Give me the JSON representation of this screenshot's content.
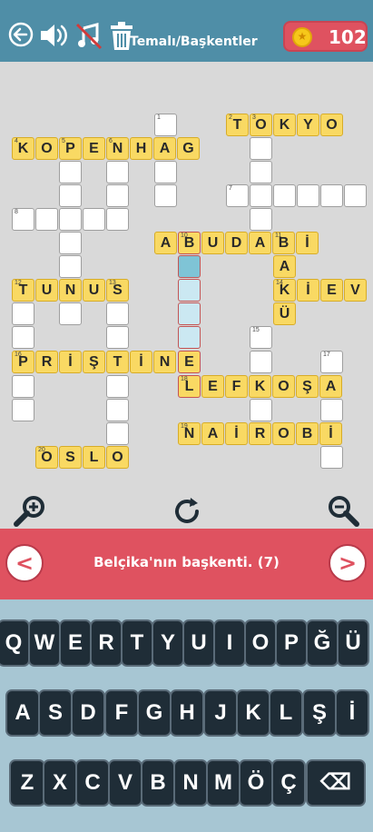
{
  "header": {
    "title": "Temalı/Başkentler",
    "coins": "102",
    "coin_symbol": "★"
  },
  "puzzle": {
    "numbers": [
      "1",
      "2",
      "3",
      "4",
      "5",
      "6",
      "7",
      "8",
      "10",
      "11",
      "12",
      "13",
      "14",
      "15",
      "16",
      "17",
      "18",
      "19",
      "20"
    ],
    "letters": {
      "tokyo": [
        "T",
        "O",
        "K",
        "Y",
        "O"
      ],
      "kopenhag": [
        "K",
        "O",
        "P",
        "E",
        "N",
        "H",
        "A",
        "G"
      ],
      "abudabi": [
        "A",
        "B",
        "U",
        "D",
        "A",
        "B",
        "İ"
      ],
      "akiev_down": [
        "A",
        "Ü"
      ],
      "tunus": [
        "T",
        "U",
        "N",
        "U",
        "S"
      ],
      "kiev": [
        "K",
        "İ",
        "E",
        "V"
      ],
      "pristine": [
        "P",
        "R",
        "İ",
        "Ş",
        "T",
        "İ",
        "N",
        "E"
      ],
      "lefkosa": [
        "L",
        "E",
        "F",
        "K",
        "O",
        "Ş",
        "A"
      ],
      "nairobi": [
        "N",
        "A",
        "İ",
        "R",
        "O",
        "B",
        "İ"
      ],
      "oslo": [
        "O",
        "S",
        "L",
        "O"
      ]
    }
  },
  "clue": {
    "text": "Belçika'nın başkenti. (7)",
    "prev": "<",
    "next": ">"
  },
  "keyboard": {
    "row1": [
      "Q",
      "W",
      "E",
      "R",
      "T",
      "Y",
      "U",
      "I",
      "O",
      "P",
      "Ğ",
      "Ü"
    ],
    "row2": [
      "A",
      "S",
      "D",
      "F",
      "G",
      "H",
      "J",
      "K",
      "L",
      "Ş",
      "İ"
    ],
    "row3": [
      "Z",
      "X",
      "C",
      "V",
      "B",
      "N",
      "M",
      "Ö",
      "Ç"
    ],
    "backspace": "⌫"
  },
  "icons": [
    "back-arrow-icon",
    "volume-icon",
    "music-off-icon",
    "trash-icon",
    "zoom-in-icon",
    "refresh-icon",
    "zoom-out-icon",
    "backspace-icon"
  ]
}
